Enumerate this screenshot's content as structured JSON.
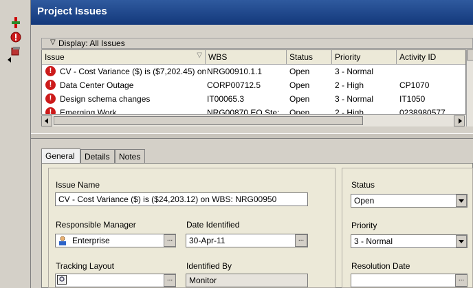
{
  "window": {
    "title": "Project Issues"
  },
  "display_bar": {
    "label": "Display: All Issues"
  },
  "grid": {
    "columns": [
      "Issue",
      "WBS",
      "Status",
      "Priority",
      "Activity ID"
    ],
    "rows": [
      {
        "issue": "CV - Cost Variance ($) is ($7,202.45) on",
        "wbs": "NRG00910.1.1",
        "status": "Open",
        "priority": "3 - Normal",
        "activity": ""
      },
      {
        "issue": "Data Center Outage",
        "wbs": "CORP00712.5",
        "status": "Open",
        "priority": "2 - High",
        "activity": "CP1070"
      },
      {
        "issue": "Design schema changes",
        "wbs": "IT00065.3",
        "status": "Open",
        "priority": "3 - Normal",
        "activity": "IT1050"
      },
      {
        "issue": "Emerging Work",
        "wbs": "NRG00870.EQ.Ste:",
        "status": "Open",
        "priority": "2 - High",
        "activity": "0238980577"
      }
    ]
  },
  "tabs": [
    "General",
    "Details",
    "Notes"
  ],
  "form": {
    "issue_name_label": "Issue Name",
    "issue_name_value": "CV - Cost Variance ($) is ($24,203.12) on WBS: NRG00950",
    "responsible_manager_label": "Responsible Manager",
    "responsible_manager_value": "Enterprise",
    "date_identified_label": "Date Identified",
    "date_identified_value": "30-Apr-11",
    "tracking_layout_label": "Tracking Layout",
    "tracking_layout_value": "",
    "identified_by_label": "Identified By",
    "identified_by_value": "Monitor",
    "status_label": "Status",
    "status_value": "Open",
    "priority_label": "Priority",
    "priority_value": "3 - Normal",
    "resolution_date_label": "Resolution Date",
    "resolution_date_value": ""
  },
  "button_glyphs": {
    "ellipsis": "..."
  },
  "icons": [
    "add-remove-columns-icon",
    "issue-warning-icon",
    "layout-icon",
    "collapse-arrow-icon"
  ],
  "colors": {
    "title_gradient_top": "#2f5a9f",
    "title_gradient_bottom": "#13387a",
    "warning_red": "#cc1b1b"
  }
}
